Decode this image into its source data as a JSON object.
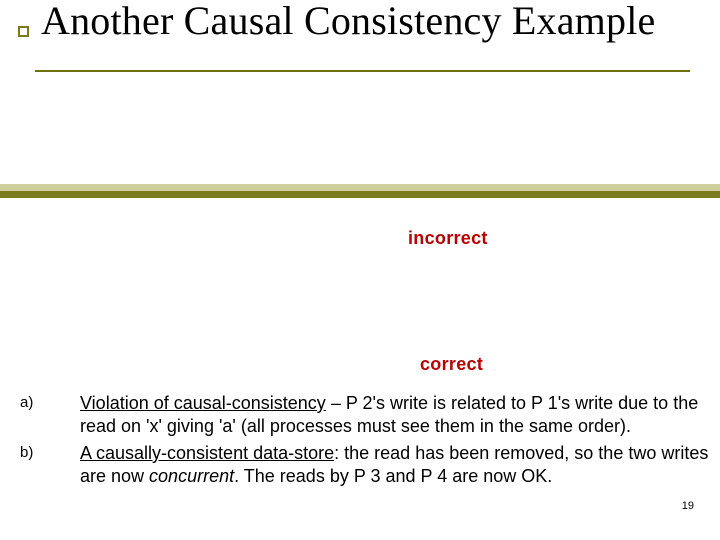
{
  "title": "Another Causal Consistency Example",
  "labels": {
    "incorrect": "incorrect",
    "correct": "correct"
  },
  "items": {
    "a": {
      "marker": "a)",
      "pre": "Violation of causal-consistency",
      "rest": " – P 2's write is related to P 1's write due to the read on 'x' giving 'a' (all processes must see them in the same order)."
    },
    "b": {
      "marker": "b)",
      "pre": "A causally-consistent data-store",
      "mid": ": the read has been removed, so the two writes are now ",
      "em": "concurrent",
      "post": ".  The reads by P 3 and P 4 are now OK."
    }
  },
  "page_number": "19"
}
